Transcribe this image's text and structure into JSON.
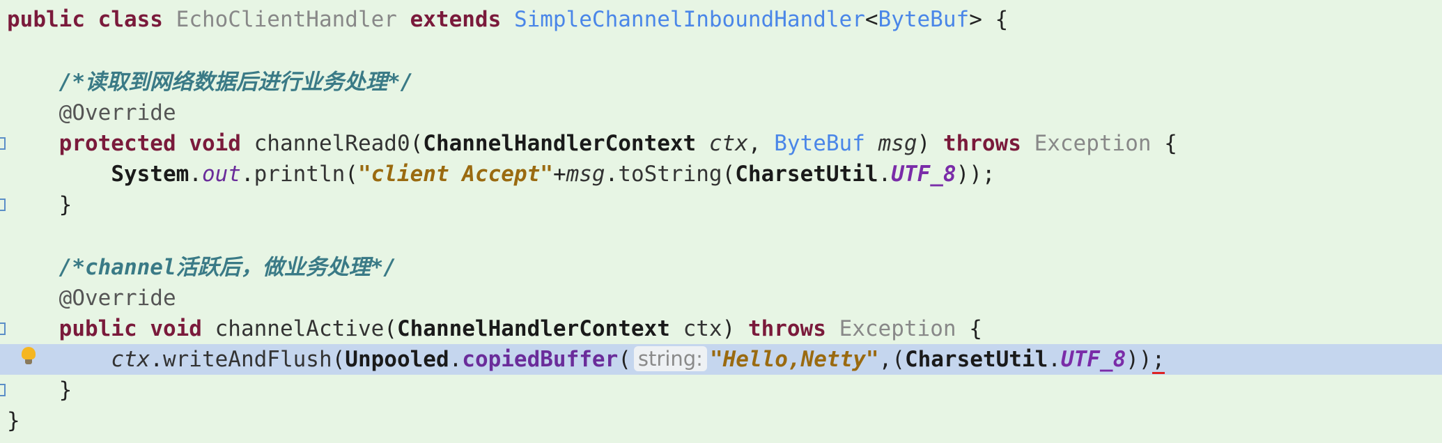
{
  "code": {
    "line1": {
      "kw_public": "public",
      "kw_class": "class",
      "class_name": "EchoClientHandler",
      "kw_extends": "extends",
      "super_class": "SimpleChannelInboundHandler",
      "generic_open": "<",
      "generic_type": "ByteBuf",
      "generic_close": ">",
      "brace": "{"
    },
    "comment1": "/*读取到网络数据后进行业务处理*/",
    "override1": "@Override",
    "method1": {
      "kw_protected": "protected",
      "kw_void": "void",
      "name": "channelRead0",
      "paren_open": "(",
      "param_type1": "ChannelHandlerContext",
      "param_name1": "ctx",
      "comma": ",",
      "param_type2": "ByteBuf",
      "param_name2": "msg",
      "paren_close": ")",
      "kw_throws": "throws",
      "exception": "Exception",
      "brace": "{"
    },
    "body1": {
      "system": "System",
      "dot1": ".",
      "out": "out",
      "dot2": ".",
      "println": "println",
      "paren_open": "(",
      "str": "\"client Accept\"",
      "plus": "+",
      "msg": "msg",
      "dot3": ".",
      "to_string": "toString",
      "paren2": "(",
      "charset": "CharsetUtil",
      "dot4": ".",
      "utf8": "UTF_8",
      "end": "));"
    },
    "close1": "}",
    "comment2": "/*channel活跃后，做业务处理*/",
    "override2": "@Override",
    "method2": {
      "kw_public": "public",
      "kw_void": "void",
      "name": "channelActive",
      "paren_open": "(",
      "param_type": "ChannelHandlerContext",
      "param_name": "ctx",
      "paren_close": ")",
      "kw_throws": "throws",
      "exception": "Exception",
      "brace": "{"
    },
    "body2": {
      "ctx": "ctx",
      "dot1": ".",
      "write": "writeAndFlush",
      "paren_open": "(",
      "unpooled": "Unpooled",
      "dot2": ".",
      "copied": "copiedBuffer",
      "paren2": "(",
      "hint": "string:",
      "str": "\"Hello,Netty\"",
      "comma": ",",
      "paren3": "(",
      "charset": "CharsetUtil",
      "dot3": ".",
      "utf8": "UTF_8",
      "close_parens": "))",
      "semicolon": ";"
    },
    "close2": "}",
    "close3": "}"
  },
  "colors": {
    "background": "#e7f5e4",
    "current_line": "#c5d6ee",
    "keyword": "#7a1a3b",
    "comment": "#3a7a86",
    "string": "#9a6a10",
    "type_link": "#4a86e8"
  },
  "icons": {
    "intention_bulb": "lightbulb-icon"
  }
}
